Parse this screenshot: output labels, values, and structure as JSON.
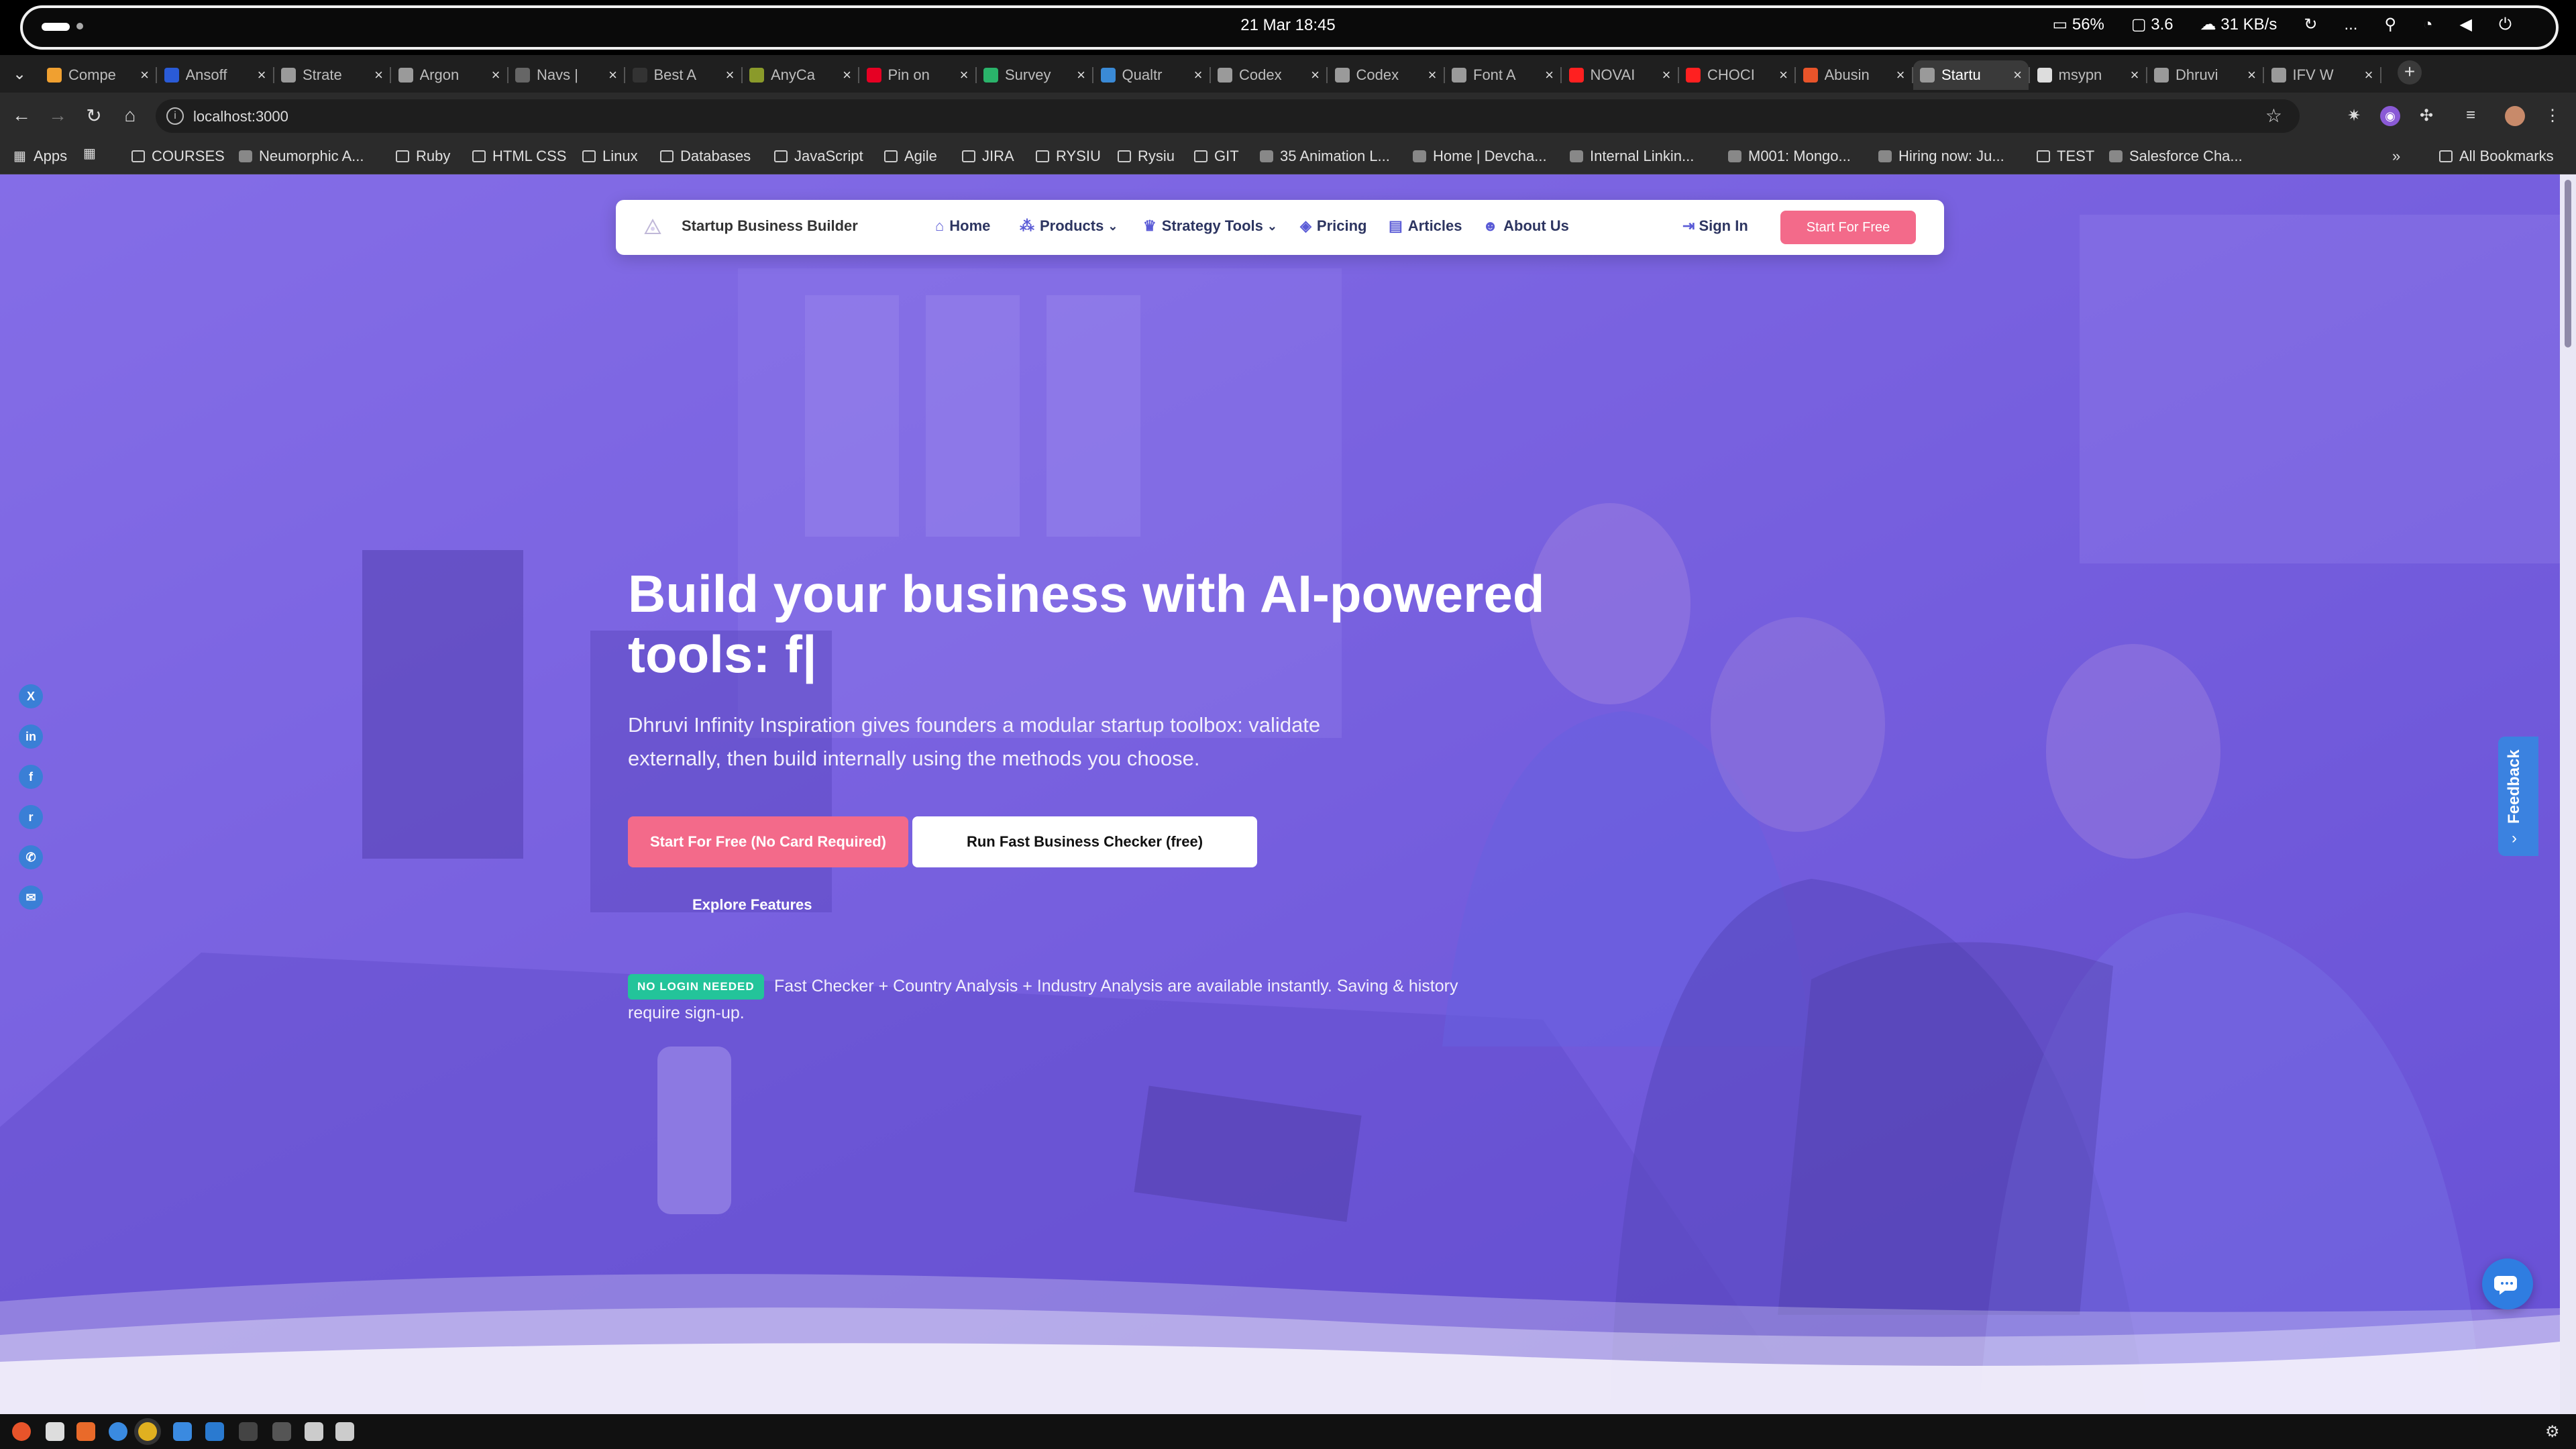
{
  "os": {
    "clock": "21 Mar  18:45",
    "battery": "56%",
    "cpu": "3.6",
    "network": "31 KB/s",
    "menu_dots": "..."
  },
  "tabs": [
    {
      "title": "Compe",
      "color": "#f0a030"
    },
    {
      "title": "Ansoff",
      "color": "#2a5bd7"
    },
    {
      "title": "Strate",
      "color": "#9a9a9a"
    },
    {
      "title": "Argon",
      "color": "#9a9a9a"
    },
    {
      "title": "Navs |",
      "color": "#666666"
    },
    {
      "title": "Best A",
      "color": "#333333"
    },
    {
      "title": "AnyCa",
      "color": "#8a9a2a"
    },
    {
      "title": "Pin on",
      "color": "#e60023"
    },
    {
      "title": "Survey",
      "color": "#2ab36a"
    },
    {
      "title": "Qualtr",
      "color": "#3a8ad6"
    },
    {
      "title": "Codex",
      "color": "#9a9a9a"
    },
    {
      "title": "Codex",
      "color": "#9a9a9a"
    },
    {
      "title": "Font A",
      "color": "#9a9a9a"
    },
    {
      "title": "NOVAI",
      "color": "#ff2020"
    },
    {
      "title": "CHOCI",
      "color": "#ff2020"
    },
    {
      "title": "Abusin",
      "color": "#e8542a"
    },
    {
      "title": "Startu",
      "color": "#9a9a9a"
    },
    {
      "title": "msypn",
      "color": "#dddddd"
    },
    {
      "title": "Dhruvi",
      "color": "#9a9a9a"
    },
    {
      "title": "IFV W",
      "color": "#9a9a9a"
    }
  ],
  "address": {
    "url": "localhost:3000"
  },
  "bookmarks": [
    {
      "label": "Apps",
      "icon": "grid"
    },
    {
      "label": "",
      "icon": "grid"
    },
    {
      "label": "COURSES",
      "icon": "folder"
    },
    {
      "label": "Neumorphic A...",
      "icon": "site"
    },
    {
      "label": "Ruby",
      "icon": "folder"
    },
    {
      "label": "HTML CSS",
      "icon": "folder"
    },
    {
      "label": "Linux",
      "icon": "folder"
    },
    {
      "label": "Databases",
      "icon": "folder"
    },
    {
      "label": "JavaScript",
      "icon": "folder"
    },
    {
      "label": "Agile",
      "icon": "folder"
    },
    {
      "label": "JIRA",
      "icon": "folder"
    },
    {
      "label": "RYSIU",
      "icon": "folder"
    },
    {
      "label": "Rysiu",
      "icon": "folder"
    },
    {
      "label": "GIT",
      "icon": "folder"
    },
    {
      "label": "35 Animation L...",
      "icon": "site"
    },
    {
      "label": "Home | Devcha...",
      "icon": "site"
    },
    {
      "label": "Internal Linkin...",
      "icon": "site"
    },
    {
      "label": "M001: Mongo...",
      "icon": "site"
    },
    {
      "label": "Hiring now: Ju...",
      "icon": "site"
    },
    {
      "label": "TEST",
      "icon": "folder"
    },
    {
      "label": "Salesforce Cha...",
      "icon": "site"
    }
  ],
  "bookmarks_overflow": "»",
  "all_bookmarks": "All Bookmarks",
  "nav": {
    "brand": "Startup Business Builder",
    "items": [
      {
        "label": "Home",
        "icon": "home-icon",
        "glyph": "⌂",
        "dropdown": false
      },
      {
        "label": "Products",
        "icon": "products-icon",
        "glyph": "⁂",
        "dropdown": true
      },
      {
        "label": "Strategy Tools",
        "icon": "chess-icon",
        "glyph": "♛",
        "dropdown": true
      },
      {
        "label": "Pricing",
        "icon": "tag-icon",
        "glyph": "◈",
        "dropdown": false
      },
      {
        "label": "Articles",
        "icon": "newspaper-icon",
        "glyph": "▤",
        "dropdown": false
      },
      {
        "label": "About Us",
        "icon": "users-icon",
        "glyph": "☻",
        "dropdown": false
      }
    ],
    "signin": "Sign In",
    "start": "Start For Free"
  },
  "hero": {
    "title_line1": "Build your business with AI-powered",
    "title_line2": "tools: f|",
    "subtitle": "Dhruvi Infinity Inspiration gives founders a modular startup toolbox: validate externally, then build internally using the methods you choose.",
    "cta_primary": "Start For Free (No Card Required)",
    "cta_secondary": "Run Fast Business Checker (free)",
    "cta_explore": "Explore Features",
    "badge": "NO LOGIN NEEDED",
    "note": "Fast Checker + Country Analysis + Industry Analysis are available instantly. Saving & history require sign-up."
  },
  "social": [
    {
      "name": "x-icon",
      "glyph": "X"
    },
    {
      "name": "linkedin-icon",
      "glyph": "in"
    },
    {
      "name": "facebook-icon",
      "glyph": "f"
    },
    {
      "name": "reddit-icon",
      "glyph": "r"
    },
    {
      "name": "whatsapp-icon",
      "glyph": "✆"
    },
    {
      "name": "email-icon",
      "glyph": "✉"
    }
  ],
  "feedback": "Feedback",
  "colors": {
    "accent": "#f36a8a",
    "brand_blue": "#3b82e0",
    "badge_green": "#23c49a",
    "overlay": "#735ae6"
  }
}
